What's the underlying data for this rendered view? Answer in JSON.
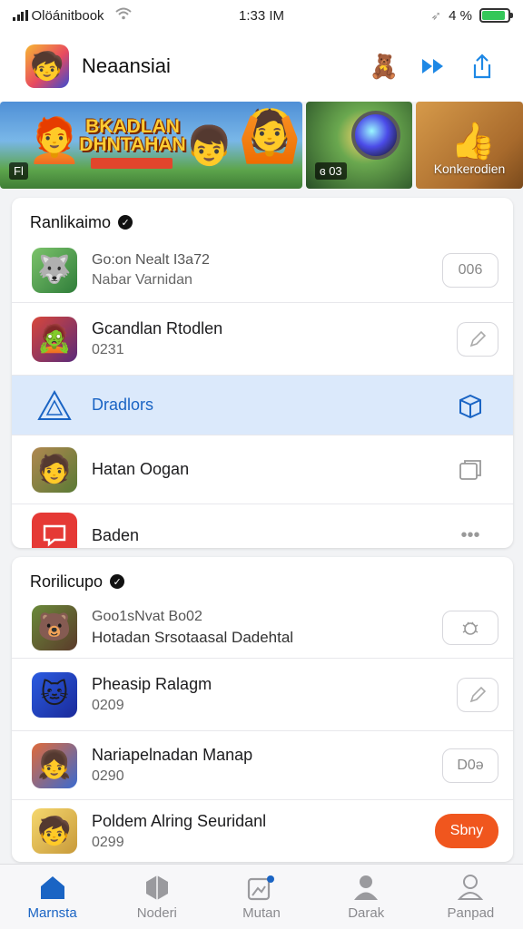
{
  "status_bar": {
    "carrier": "Olöánitbook",
    "time": "1:33 IM",
    "battery": "4 %",
    "battery_level": 0.9,
    "battery_color": "#34c759"
  },
  "header": {
    "title": "Neaansiai"
  },
  "banner": {
    "title": "BKADLAN DHNTAHAN",
    "slides": [
      {
        "tag": "Fl"
      },
      {
        "tag": "ɞ 03"
      },
      {
        "label": "Konkerodien"
      }
    ]
  },
  "section1": {
    "title": "Ranlikaimo",
    "items": [
      {
        "title": "Go:on Nealt I3a72",
        "subtitle": "Nabar Varnidan",
        "action": "006"
      },
      {
        "title": "Gcandlan Rtodlen",
        "subtitle": "0231"
      },
      {
        "title": "Dradlors"
      },
      {
        "title": "Hatan Oogan"
      },
      {
        "title": "Baden"
      }
    ]
  },
  "section2": {
    "title": "Rorilicupo",
    "items": [
      {
        "title": "Goo1sNvat Bo02",
        "subtitle": "Hotadan Srsotaasal Dadehtal"
      },
      {
        "title": "Pheasip Ralagm",
        "subtitle": "0209"
      },
      {
        "title": "Nariapelnadan Manap",
        "subtitle": "0290",
        "action": "D0ə"
      },
      {
        "title": "Poldem Alring Seuridanl",
        "subtitle": "0299",
        "action": "Sbny"
      }
    ]
  },
  "bottom_nav": [
    {
      "label": "Marnsta",
      "active": true
    },
    {
      "label": "Noderi"
    },
    {
      "label": "Mutan"
    },
    {
      "label": "Darak"
    },
    {
      "label": "Panpad"
    }
  ],
  "colors": {
    "accent": "#1a64c4",
    "cta": "#f0561e",
    "highlight": "#dbe9fb"
  }
}
